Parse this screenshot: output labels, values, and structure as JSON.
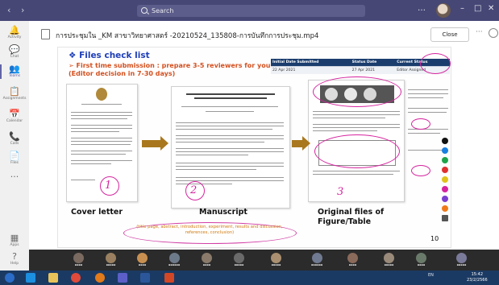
{
  "app": {
    "search_placeholder": "Search",
    "window_controls": [
      "…",
      "–",
      "□",
      "✕"
    ]
  },
  "rail": [
    {
      "icon": "activity-icon",
      "glyph": "🔔",
      "label": "Activity"
    },
    {
      "icon": "chat-icon",
      "glyph": "💬",
      "label": "Chat"
    },
    {
      "icon": "teams-icon",
      "glyph": "👥",
      "label": "Teams",
      "active": true
    },
    {
      "icon": "assignments-icon",
      "glyph": "📋",
      "label": "Assignments"
    },
    {
      "icon": "calendar-icon",
      "glyph": "📅",
      "label": "Calendar"
    },
    {
      "icon": "calls-icon",
      "glyph": "📞",
      "label": "Calls"
    },
    {
      "icon": "files-icon",
      "glyph": "📄",
      "label": "Files"
    },
    {
      "icon": "more-icon",
      "glyph": "···",
      "label": ""
    },
    {
      "icon": "apps-icon",
      "glyph": "▦",
      "label": "Apps"
    },
    {
      "icon": "help-icon",
      "glyph": "?",
      "label": "Help"
    }
  ],
  "file": {
    "title": "การประชุมใน _KM สาขาวิทยาศาสตร์ -20210524_135808-การบันทึกการประชุม.mp4",
    "close_label": "Close"
  },
  "slide": {
    "heading": "❖ Files check list",
    "subheading": "➢ First time submission : prepare 3-5 reviewers for your paper (Editor decision in 7-30 days)",
    "table": {
      "headers": [
        "Initial Date Submitted",
        "Status Date",
        "Current Status"
      ],
      "row": [
        "22 Apr 2021",
        "27 Apr 2021",
        "Editor Assigned"
      ]
    },
    "captions": {
      "cover": "Cover letter",
      "manuscript": "Manuscript",
      "figures": "Original files of Figure/Table"
    },
    "manuscript_note": "(title page, abstract, introduction, experiment, results and discussion, references, conclusion)",
    "page_number": "10",
    "pen_numbers": [
      "1",
      "2",
      "3"
    ]
  },
  "taskbar": {
    "language": "EN",
    "time": "15:42",
    "date": "23/2/2566"
  }
}
